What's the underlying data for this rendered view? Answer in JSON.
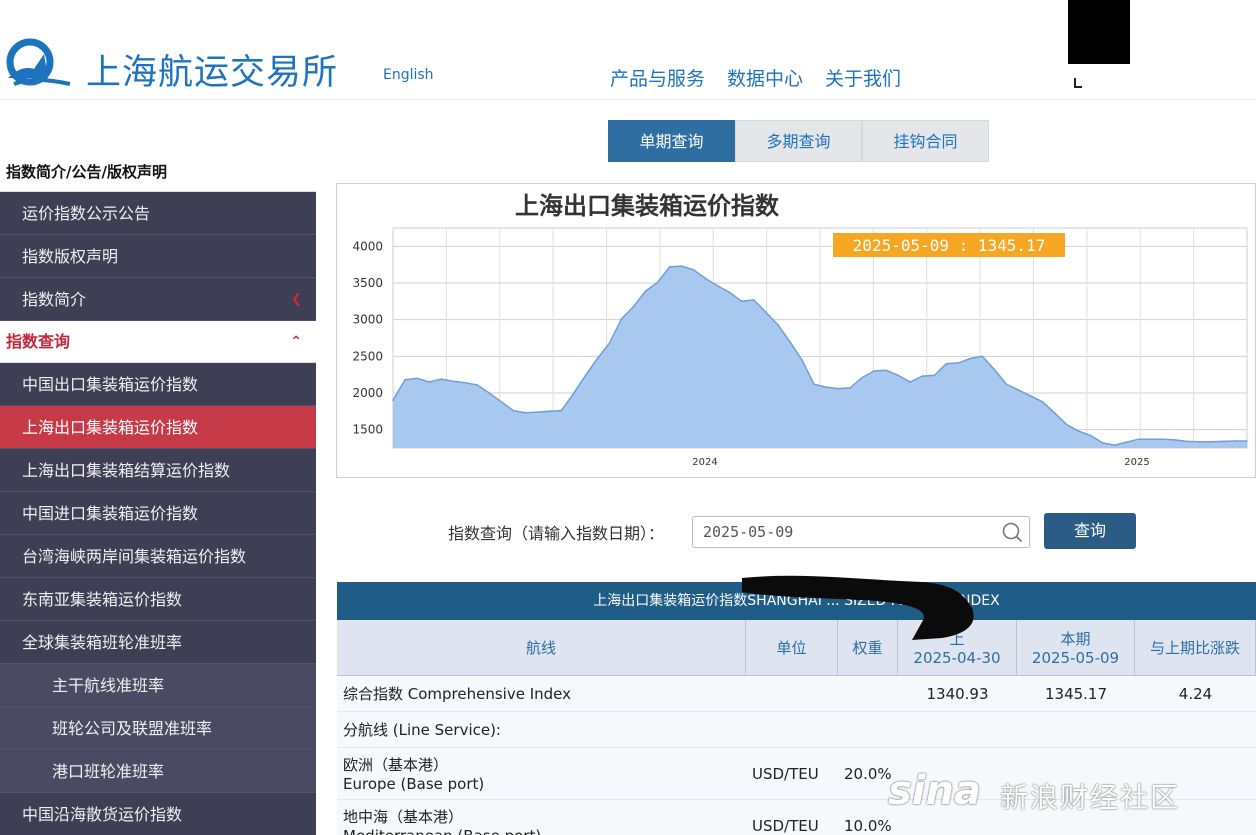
{
  "header": {
    "logo_text": "上海航运交易所",
    "english_link": "English",
    "nav": [
      "产品与服务",
      "数据中心",
      "关于我们"
    ]
  },
  "sidebar": {
    "section1_title": "指数简介/公告/版权声明",
    "section1_items": [
      "运价指数公示公告",
      "指数版权声明",
      "指数简介"
    ],
    "section2_title": "指数查询",
    "section2_items": [
      {
        "label": "中国出口集装箱运价指数",
        "sub": false,
        "active": false
      },
      {
        "label": "上海出口集装箱运价指数",
        "sub": false,
        "active": true
      },
      {
        "label": "上海出口集装箱结算运价指数",
        "sub": false,
        "active": false
      },
      {
        "label": "中国进口集装箱运价指数",
        "sub": false,
        "active": false
      },
      {
        "label": "台湾海峡两岸间集装箱运价指数",
        "sub": false,
        "active": false
      },
      {
        "label": "东南亚集装箱运价指数",
        "sub": false,
        "active": false
      },
      {
        "label": "全球集装箱班轮准班率",
        "sub": false,
        "active": false
      },
      {
        "label": "主干航线准班率",
        "sub": true,
        "active": false
      },
      {
        "label": "班轮公司及联盟准班率",
        "sub": true,
        "active": false
      },
      {
        "label": "港口班轮准班率",
        "sub": true,
        "active": false
      },
      {
        "label": "中国沿海散货运价指数",
        "sub": false,
        "active": false
      }
    ]
  },
  "tabs": [
    "单期查询",
    "多期查询",
    "挂钩合同"
  ],
  "chart_data": {
    "type": "area",
    "title": "上海出口集装箱运价指数",
    "tooltip": "2025-05-09 : 1345.17",
    "y_ticks": [
      1500,
      2000,
      2500,
      3000,
      3500,
      4000
    ],
    "x_ticks": [
      "2024",
      "2025"
    ],
    "ylim": [
      1250,
      4250
    ],
    "grid": true,
    "x": [
      0,
      1,
      2,
      3,
      4,
      5,
      6,
      7,
      8,
      9,
      10,
      11,
      12,
      13,
      14,
      15,
      16,
      17,
      18,
      19,
      20,
      21,
      22,
      23,
      24,
      25,
      26,
      27,
      28,
      29,
      30,
      31,
      32,
      33,
      34,
      35,
      36,
      37,
      38,
      39,
      40,
      41,
      42,
      43,
      44,
      45,
      46,
      47,
      48,
      49,
      50,
      51,
      52,
      53,
      54,
      55,
      56,
      57,
      58,
      59,
      60,
      61,
      62,
      63,
      64,
      65,
      66,
      67,
      68,
      69,
      70,
      71
    ],
    "values": [
      1900,
      2180,
      2200,
      2150,
      2190,
      2160,
      2140,
      2110,
      2000,
      1880,
      1760,
      1730,
      1740,
      1750,
      1760,
      1990,
      2240,
      2470,
      2680,
      3010,
      3180,
      3390,
      3510,
      3720,
      3730,
      3680,
      3560,
      3460,
      3370,
      3250,
      3270,
      3100,
      2930,
      2700,
      2450,
      2120,
      2080,
      2060,
      2070,
      2210,
      2300,
      2310,
      2240,
      2150,
      2230,
      2240,
      2400,
      2410,
      2470,
      2500,
      2320,
      2120,
      2040,
      1960,
      1880,
      1730,
      1570,
      1480,
      1420,
      1320,
      1290,
      1330,
      1370,
      1370,
      1370,
      1360,
      1340,
      1335,
      1335,
      1340,
      1345,
      1345
    ]
  },
  "query": {
    "label": "指数查询（请输入指数日期）：",
    "value": "2025-05-09",
    "button": "查询"
  },
  "table": {
    "title": "上海出口集装箱运价指数SHANGHAI ... SIZED FREIGHT INDEX",
    "headers": {
      "route": "航线",
      "unit": "单位",
      "weight": "权重",
      "prev_label": "上",
      "prev_date": "2025-04-30",
      "cur_label": "本期",
      "cur_date": "2025-05-09",
      "change": "与上期比涨跌"
    },
    "rows": [
      {
        "route": "综合指数 Comprehensive Index",
        "route2": "",
        "unit": "",
        "weight": "",
        "prev": "1340.93",
        "cur": "1345.17",
        "change": "4.24"
      },
      {
        "route": "分航线 (Line Service):",
        "route2": "",
        "unit": "",
        "weight": "",
        "prev": "",
        "cur": "",
        "change": ""
      },
      {
        "route": "欧洲（基本港）",
        "route2": "Europe (Base port)",
        "unit": "USD/TEU",
        "weight": "20.0%",
        "prev": "",
        "cur": "",
        "change": ""
      },
      {
        "route": "地中海（基本港）",
        "route2": "Mediterranean (Base port)",
        "unit": "USD/TEU",
        "weight": "10.0%",
        "prev": "",
        "cur": "",
        "change": ""
      }
    ]
  },
  "watermark": {
    "brand": "sina",
    "text": "新浪财经社区"
  },
  "colors": {
    "brand_blue": "#1e73be",
    "sidebar_bg": "#3e3f55",
    "active_red": "#c63a48",
    "chart_fill": "#a8c8f0",
    "chart_line": "#6e9fd6",
    "tooltip_bg": "#f5a623",
    "table_header": "#1f5c86"
  }
}
